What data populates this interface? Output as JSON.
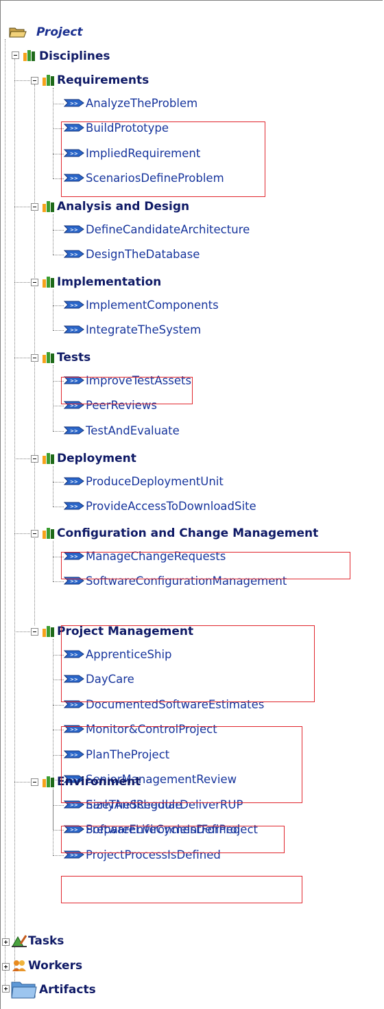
{
  "tree": {
    "root_label": "Project",
    "disciplines_label": "Disciplines",
    "disciplines": [
      {
        "label": "Requirements",
        "tasks": [
          "AnalyzeTheProblem",
          "BuildPrototype",
          "ImpliedRequirement",
          "ScenariosDefineProblem"
        ]
      },
      {
        "label": "Analysis and Design",
        "tasks": [
          "DefineCandidateArchitecture",
          "DesignTheDatabase"
        ]
      },
      {
        "label": "Implementation",
        "tasks": [
          "ImplementComponents",
          "IntegrateTheSystem"
        ]
      },
      {
        "label": "Tests",
        "tasks": [
          "ImproveTestAssets",
          "PeerReviews",
          "TestAndEvaluate"
        ]
      },
      {
        "label": "Deployment",
        "tasks": [
          "ProduceDeploymentUnit",
          "ProvideAccessToDownloadSite"
        ]
      },
      {
        "label": "Configuration and Change Management",
        "tasks": [
          "ManageChangeRequests",
          "SoftwareConfigurationManagement"
        ]
      },
      {
        "label": "Project Management",
        "tasks": [
          "ApprenticeShip",
          "DayCare",
          "DocumentedSoftwareEstimates",
          "Monitor&ControlProject",
          "PlanTheProject",
          "SeniorManagementReview",
          "SizeTheSchedule",
          "SoftwareLifeCycleIsDefined"
        ]
      },
      {
        "label": "Environment",
        "tasks": [
          "EarlyAndRegularDeliverRUP",
          "PrepareEnvironmentForProject",
          "ProjectProcessIsDefined"
        ]
      }
    ],
    "bottom_nodes": [
      "Tasks",
      "Workers",
      "Artifacts"
    ]
  },
  "highlight_color": "#e0242b",
  "icons": {
    "root": "folder-open-icon",
    "discipline": "discipline-bars-icon",
    "task": "task-arrow-icon",
    "tasks_node": "tasks-icon",
    "workers_node": "workers-icon",
    "artifacts_node": "artifacts-folder-icon"
  }
}
